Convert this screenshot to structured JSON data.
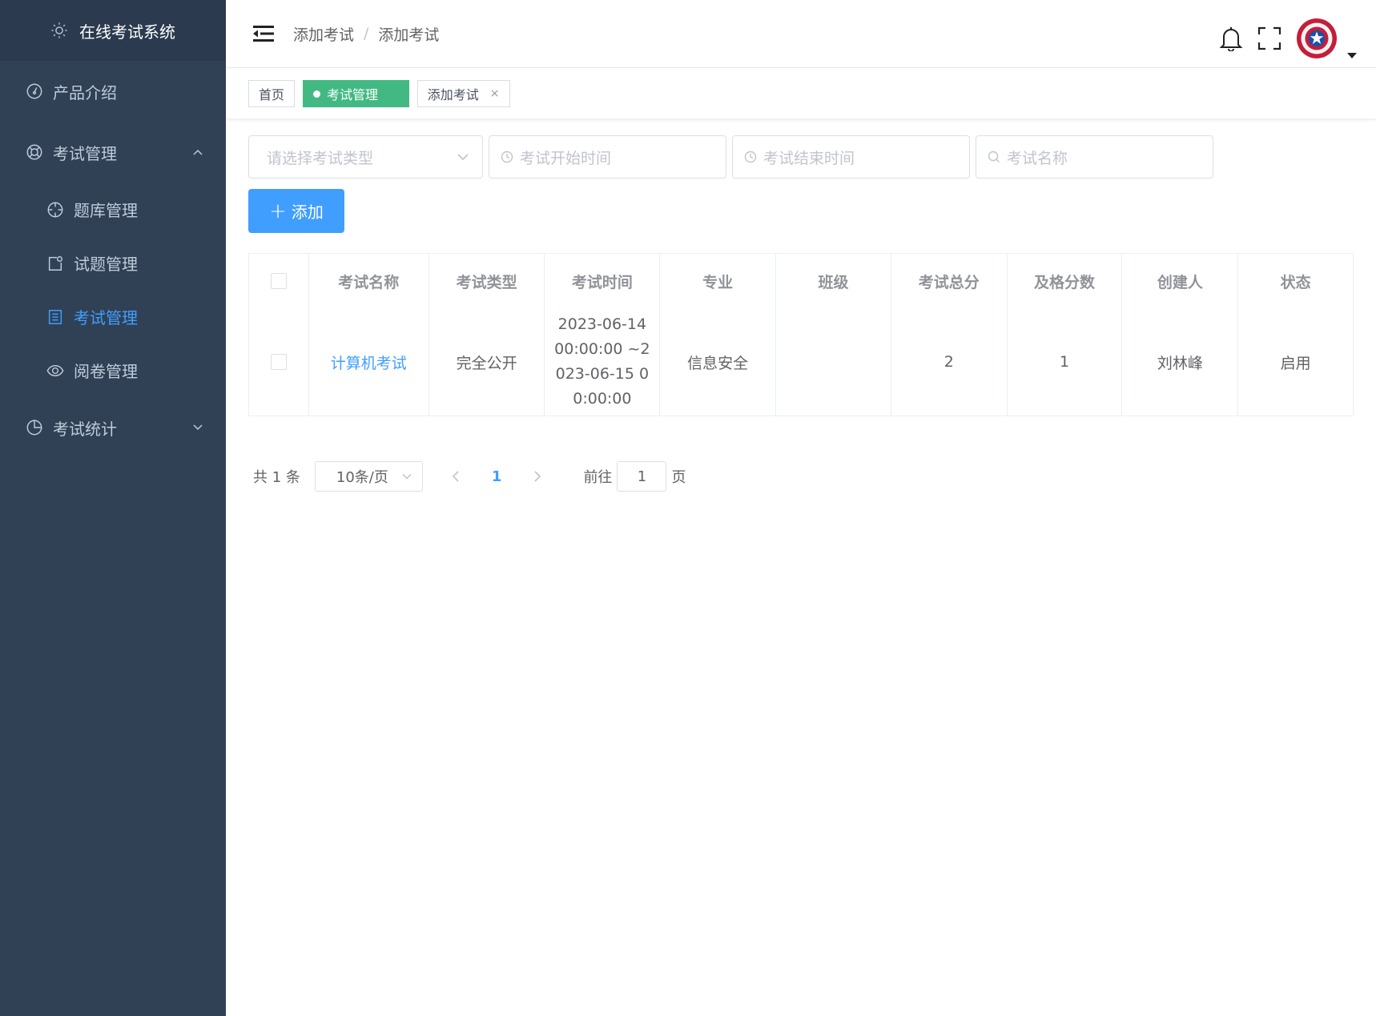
{
  "sidebar": {
    "title": "在线考试系统",
    "items": [
      {
        "label": "产品介绍"
      },
      {
        "label": "考试管理"
      },
      {
        "label": "考试统计"
      }
    ],
    "submenu": [
      {
        "label": "题库管理"
      },
      {
        "label": "试题管理"
      },
      {
        "label": "考试管理"
      },
      {
        "label": "阅卷管理"
      }
    ],
    "active_color": "#409eff"
  },
  "header": {
    "breadcrumb": [
      "添加考试",
      "添加考试"
    ],
    "breadcrumb_sep": "/"
  },
  "tags": [
    {
      "label": "首页"
    },
    {
      "label": "考试管理"
    },
    {
      "label": "添加考试"
    }
  ],
  "tag_close": "×",
  "filters": {
    "type_placeholder": "请选择考试类型",
    "start_placeholder": "考试开始时间",
    "end_placeholder": "考试结束时间",
    "name_placeholder": "考试名称"
  },
  "add_button": {
    "label": "添加"
  },
  "table": {
    "columns": [
      "考试名称",
      "考试类型",
      "考试时间",
      "专业",
      "班级",
      "考试总分",
      "及格分数",
      "创建人",
      "状态"
    ],
    "rows": [
      {
        "name": "计算机考试",
        "type": "完全公开",
        "time": "2023-06-14 00:00:00 ~2023-06-15 00:00:00",
        "major": "信息安全",
        "class": "",
        "total": "2",
        "pass": "1",
        "creator": "刘林峰",
        "status": "启用"
      }
    ]
  },
  "pagination": {
    "total_text": "共 1 条",
    "page_size": "10条/页",
    "current_page": "1",
    "goto_label": "前往",
    "goto_value": "1",
    "page_suffix": "页"
  }
}
